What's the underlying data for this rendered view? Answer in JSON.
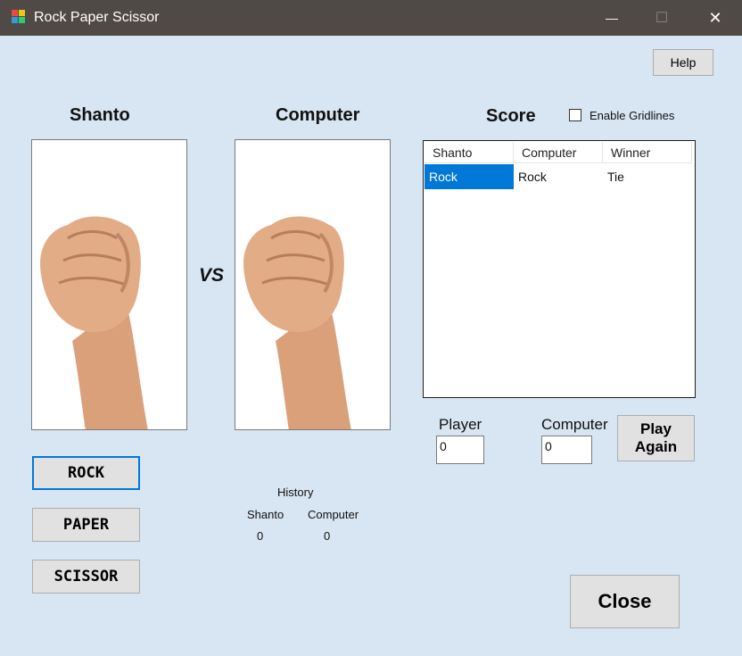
{
  "window": {
    "title": "Rock Paper Scissor",
    "minimize_glyph": "—",
    "maximize_glyph": "☐",
    "close_glyph": "✕"
  },
  "help_label": "Help",
  "player_heading": "Shanto",
  "computer_heading": "Computer",
  "vs_label": "VS",
  "score_heading": "Score",
  "gridlines": {
    "label": "Enable Gridlines",
    "checked": false
  },
  "score_table": {
    "columns": [
      "Shanto",
      "Computer",
      "Winner"
    ],
    "rows": [
      [
        "Rock",
        "Rock",
        "Tie"
      ]
    ],
    "selected_row": 0
  },
  "choices": {
    "rock": "ROCK",
    "paper": "PAPER",
    "scissor": "SCISSOR"
  },
  "history": {
    "title": "History",
    "player_label": "Shanto",
    "computer_label": "Computer",
    "player_value": "0",
    "computer_value": "0"
  },
  "score_inputs": {
    "player_label": "Player",
    "player_value": "0",
    "computer_label": "Computer",
    "computer_value": "0"
  },
  "play_again_line1": "Play",
  "play_again_line2": "Again",
  "close_label": "Close",
  "player_image": "rock-fist-icon",
  "computer_image": "rock-fist-icon",
  "colors": {
    "titlebar": "#4f4a46",
    "background": "#d8e5f2",
    "selection": "#0078d7",
    "focus_border": "#0078d7"
  }
}
